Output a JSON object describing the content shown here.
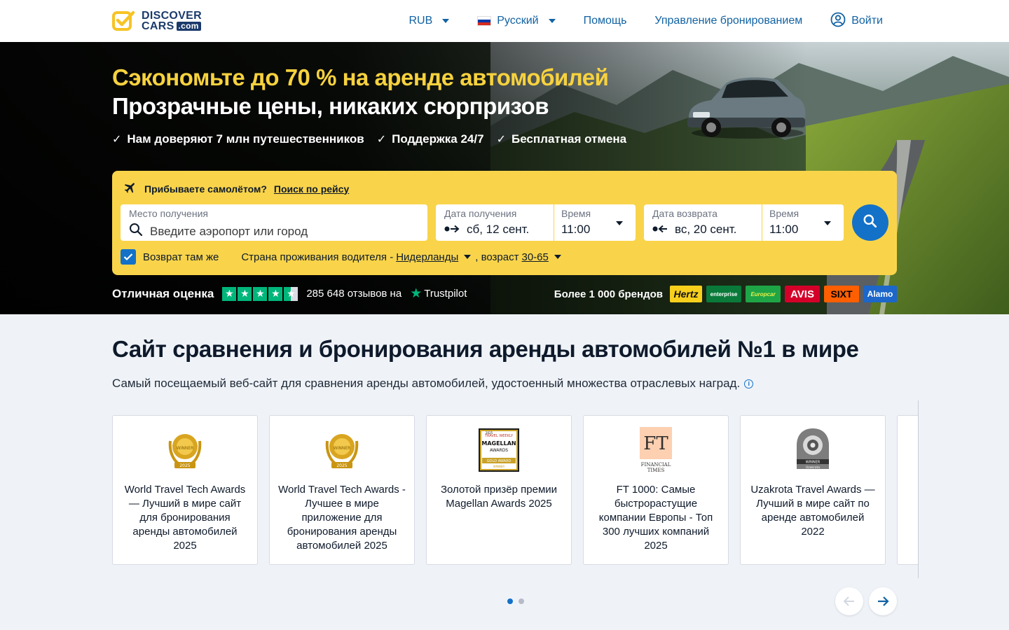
{
  "header": {
    "logo_top": "DISCOVER",
    "logo_bottom": "CARS",
    "logo_com": ".com",
    "currency": "RUB",
    "language": "Русский",
    "help": "Помощь",
    "manage_booking": "Управление бронированием",
    "login": "Войти"
  },
  "hero": {
    "headline": "Сэкономьте до 70 % на аренде автомобилей",
    "subheadline": "Прозрачные цены, никаких сюрпризов",
    "benefits": [
      "Нам доверяют 7 млн путешественников",
      "Поддержка 24/7",
      "Бесплатная отмена"
    ]
  },
  "search": {
    "flight_prompt": "Прибываете самолётом?",
    "flight_link": "Поиск по рейсу",
    "pickup_location_label": "Место получения",
    "pickup_location_placeholder": "Введите аэропорт или город",
    "pickup_date_label": "Дата получения",
    "pickup_date_value": "сб, 12 сент.",
    "pickup_time_label": "Время",
    "pickup_time_value": "11:00",
    "return_date_label": "Дата возврата",
    "return_date_value": "вс, 20 сент.",
    "return_time_label": "Время",
    "return_time_value": "11:00",
    "same_return_label": "Возврат там же",
    "same_return_checked": true,
    "residence_label": "Страна проживания водителя -",
    "residence_value": "Нидерланды",
    "age_label": ", возраст",
    "age_value": "30-65"
  },
  "trust": {
    "rating_text": "Отличная оценка",
    "stars": 4.5,
    "reviews_text": "285 648 отзывов на",
    "provider": "Trustpilot",
    "star_color": "#00b67a"
  },
  "brands": {
    "label": "Более 1 000 брендов",
    "items": [
      "Hertz",
      "enterprise",
      "Europcar",
      "AVIS",
      "SIXT",
      "Alamo"
    ]
  },
  "main": {
    "title": "Сайт сравнения и бронирования аренды автомобилей №1 в мире",
    "subtitle": "Самый посещаемый веб-сайт для сравнения аренды автомобилей, удостоенный множества отраслевых наград."
  },
  "awards": [
    {
      "caption": "World Travel Tech Awards — Лучший в мире сайт для бронирования аренды автомобилей 2025",
      "icon": "wtta-laurel-icon"
    },
    {
      "caption": "World Travel Tech Awards - Лучшее в мире приложение для бронирования аренды автомобилей 2025",
      "icon": "wtta-laurel-icon"
    },
    {
      "caption": "Золотой призёр премии Magellan Awards 2025",
      "icon": "magellan-award-icon"
    },
    {
      "caption": "FT 1000: Самые быстрорастущие компании Европы - Топ 300 лучших компаний 2025",
      "icon": "ft-logo-icon"
    },
    {
      "caption": "Uzakrota Travel Awards — Лучший в мире сайт по аренде автомобилей 2022",
      "icon": "uzakrota-award-icon"
    }
  ],
  "award_badges": {
    "magellan_year": "2025",
    "magellan_top": "TRAVEL WEEKLY",
    "magellan_name": "MAGELLAN",
    "magellan_awards": "AWARDS",
    "magellan_gold": "GOLD AWARD",
    "magellan_winner": "WINNER",
    "ft_letters": "FT",
    "ft_line1": "FINANCIAL",
    "ft_line2": "TIMES",
    "uzakrota_winner": "WINNER",
    "uzakrota_brand": "Uzakrota",
    "wtta_year": "2025",
    "wtta_winner": "WINNER"
  },
  "carousel": {
    "pages": 2,
    "active_page": 1
  },
  "colors": {
    "brand_yellow": "#f9d44a",
    "headline_yellow": "#f7d23e",
    "primary_blue": "#1371c8",
    "nav_blue": "#1162a3"
  }
}
